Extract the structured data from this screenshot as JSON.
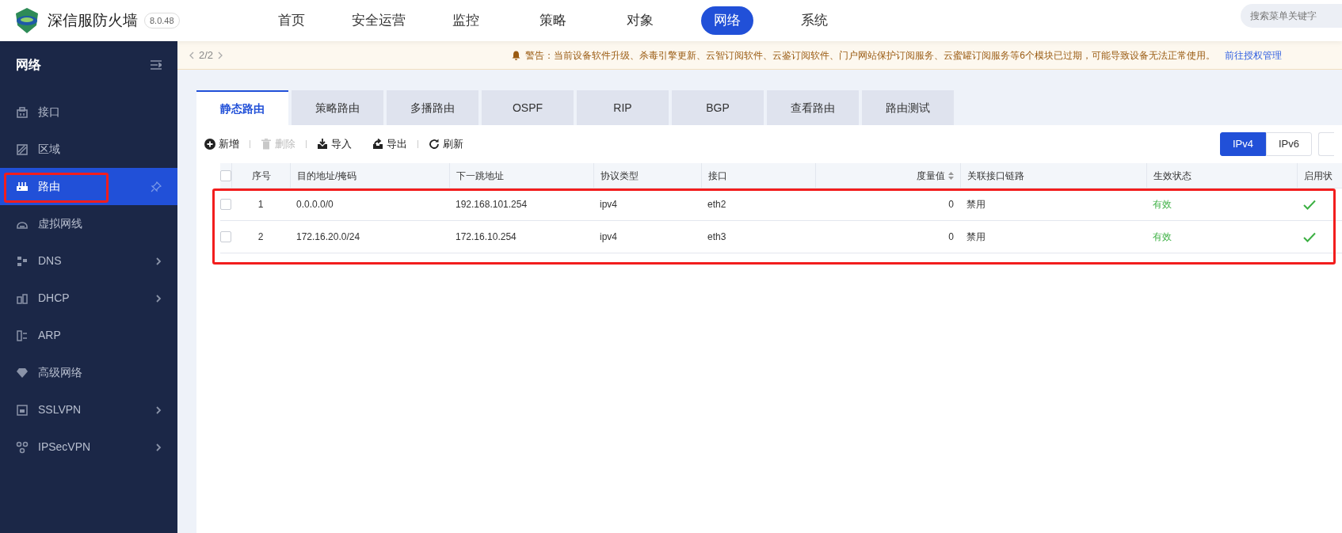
{
  "app": {
    "title": "深信服防火墙",
    "version": "8.0.48"
  },
  "nav": [
    {
      "label": "首页",
      "selected": false
    },
    {
      "label": "安全运营",
      "selected": false
    },
    {
      "label": "监控",
      "selected": false
    },
    {
      "label": "策略",
      "selected": false
    },
    {
      "label": "对象",
      "selected": false
    },
    {
      "label": "网络",
      "selected": true
    },
    {
      "label": "系统",
      "selected": false
    }
  ],
  "search": {
    "placeholder": "搜索菜单关键字"
  },
  "sidebar": {
    "title": "网络",
    "items": [
      {
        "label": "接口",
        "selected": false,
        "has_submenu": false
      },
      {
        "label": "区域",
        "selected": false,
        "has_submenu": false
      },
      {
        "label": "路由",
        "selected": true,
        "has_submenu": false
      },
      {
        "label": "虚拟网线",
        "selected": false,
        "has_submenu": false
      },
      {
        "label": "DNS",
        "selected": false,
        "has_submenu": true
      },
      {
        "label": "DHCP",
        "selected": false,
        "has_submenu": true
      },
      {
        "label": "ARP",
        "selected": false,
        "has_submenu": false
      },
      {
        "label": "高级网络",
        "selected": false,
        "has_submenu": false
      },
      {
        "label": "SSLVPN",
        "selected": false,
        "has_submenu": true
      },
      {
        "label": "IPSecVPN",
        "selected": false,
        "has_submenu": true
      }
    ]
  },
  "notice": {
    "pager": "2/2",
    "message": "警告：当前设备软件升级、杀毒引擎更新、云智订阅软件、云鉴订阅软件、门户网站保护订阅服务、云蜜罐订阅服务等6个模块已过期，可能导致设备无法正常使用。",
    "link": "前往授权管理"
  },
  "tabs": [
    {
      "label": "静态路由",
      "selected": true
    },
    {
      "label": "策略路由",
      "selected": false
    },
    {
      "label": "多播路由",
      "selected": false
    },
    {
      "label": "OSPF",
      "selected": false
    },
    {
      "label": "RIP",
      "selected": false
    },
    {
      "label": "BGP",
      "selected": false
    },
    {
      "label": "查看路由",
      "selected": false
    },
    {
      "label": "路由测试",
      "selected": false
    }
  ],
  "toolbar": [
    {
      "label": "新增",
      "disabled": false
    },
    {
      "label": "删除",
      "disabled": true
    },
    {
      "label": "导入",
      "disabled": false
    },
    {
      "label": "导出",
      "disabled": false
    },
    {
      "label": "刷新",
      "disabled": false
    }
  ],
  "ip_version": [
    {
      "label": "IPv4",
      "selected": true
    },
    {
      "label": "IPv6",
      "selected": false
    }
  ],
  "table": {
    "header_checked": false,
    "columns": [
      {
        "label": "序号"
      },
      {
        "label": "目的地址/掩码"
      },
      {
        "label": "下一跳地址"
      },
      {
        "label": "协议类型"
      },
      {
        "label": "接口"
      },
      {
        "label": "度量值",
        "sortable": true
      },
      {
        "label": "关联接口链路"
      },
      {
        "label": "生效状态"
      },
      {
        "label": "启用状"
      }
    ],
    "rows": [
      {
        "checked": false,
        "cells": [
          "1",
          "0.0.0.0/0",
          "192.168.101.254",
          "ipv4",
          "eth2",
          "0",
          "禁用",
          "有效"
        ],
        "enabled": true
      },
      {
        "checked": false,
        "cells": [
          "2",
          "172.16.20.0/24",
          "172.16.10.254",
          "ipv4",
          "eth3",
          "0",
          "禁用",
          "有效"
        ],
        "enabled": true
      }
    ]
  }
}
